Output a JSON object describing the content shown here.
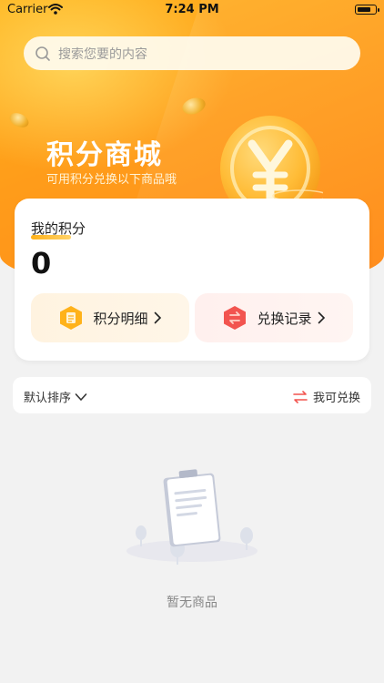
{
  "status_bar": {
    "carrier": "Carrier",
    "time": "7:24 PM"
  },
  "search": {
    "placeholder": "搜索您要的内容"
  },
  "hero": {
    "title": "积分商城",
    "subtitle": "可用积分兑换以下商品哦"
  },
  "points_card": {
    "label": "我的积分",
    "value": "0",
    "detail_label": "积分明细",
    "record_label": "兑换记录"
  },
  "filter_bar": {
    "sort_label": "默认排序",
    "exchange_label": "我可兑换"
  },
  "empty_state": {
    "text": "暂无商品"
  },
  "colors": {
    "brand_orange": "#ff9c1a",
    "accent_red": "#f2544f"
  }
}
